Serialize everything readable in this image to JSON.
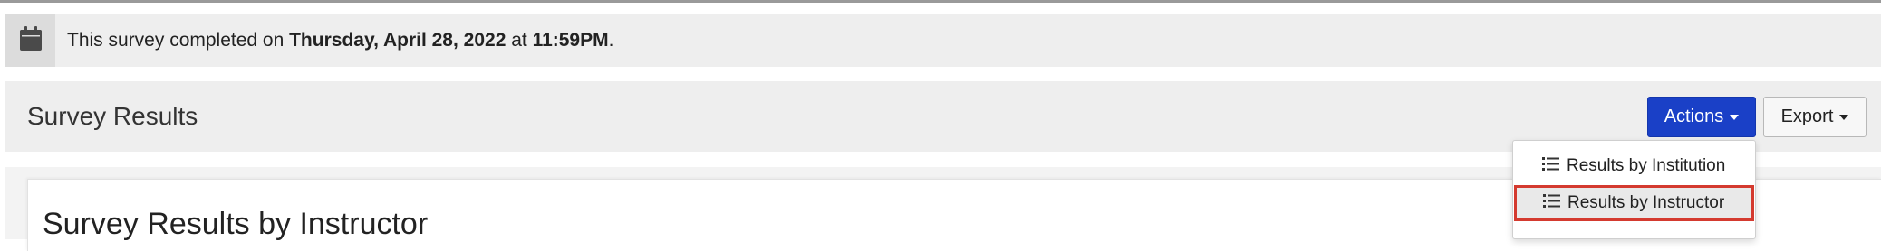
{
  "banner": {
    "prefix": "This survey completed on ",
    "date": "Thursday, April 28, 2022",
    "middle": " at ",
    "time": "11:59PM",
    "suffix": ".",
    "icon": "calendar-icon"
  },
  "results_bar": {
    "title": "Survey Results",
    "actions_label": "Actions",
    "export_label": "Export"
  },
  "dropdown": {
    "items": [
      {
        "label": "Results by Institution",
        "icon": "list-icon"
      },
      {
        "label": "Results by Instructor",
        "icon": "list-icon",
        "highlighted": true
      }
    ]
  },
  "card": {
    "title": "Survey Results by Instructor"
  },
  "colors": {
    "primary_button": "#1a40c7",
    "highlight_border": "#d43a2f",
    "banner_bg": "#eeeeee"
  }
}
